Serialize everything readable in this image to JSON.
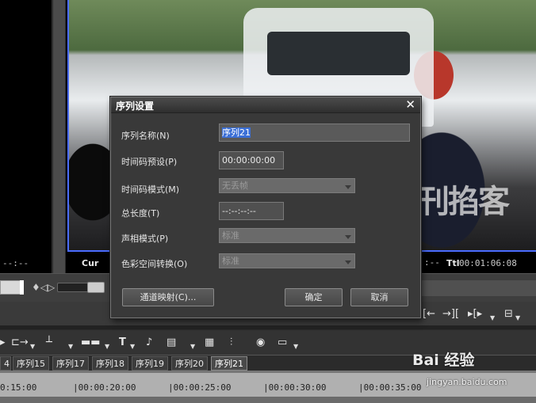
{
  "viewer": {
    "left_timecode": "--:--",
    "cur_label": "Cur",
    "ttl_label": "Ttl",
    "ttl_value": "00:01:06:08",
    "cur_value": ":--",
    "video_overlay_text": "刊掐客"
  },
  "dialog": {
    "title": "序列设置",
    "close_glyph": "✕",
    "fields": {
      "name_label": "序列名称(N)",
      "name_value": "序列21",
      "timecode_preset_label": "时间码预设(P)",
      "timecode_preset_value": "00:00:00:00",
      "timecode_mode_label": "时间码模式(M)",
      "timecode_mode_value": "无丢帧",
      "total_length_label": "总长度(T)",
      "total_length_value": "--:--:--:--",
      "audio_mode_label": "声相模式(P)",
      "audio_mode_value": "标准",
      "color_space_label": "色彩空间转换(O)",
      "color_space_value": "标准"
    },
    "buttons": {
      "channel_map": "通道映射(C)...",
      "ok": "确定",
      "cancel": "取消"
    }
  },
  "tabs": [
    "4",
    "序列15",
    "序列17",
    "序列18",
    "序列19",
    "序列20",
    "序列21"
  ],
  "active_tab_index": 6,
  "ruler": [
    "0:15:00",
    "|00:00:20:00",
    "|00:00:25:00",
    "|00:00:30:00",
    "|00:00:35:00"
  ],
  "watermark": {
    "brand": "Bai 经验",
    "url": "jingyan.baidu.com"
  },
  "toolbar": {
    "glyphs": [
      "↲",
      "⊥",
      "▬",
      "T",
      "🎤",
      "▤",
      "≡",
      "⫶",
      "◉",
      "▬"
    ]
  },
  "colors": {
    "accent_blue": "#4a6cff",
    "selection": "#3b6fd6"
  }
}
